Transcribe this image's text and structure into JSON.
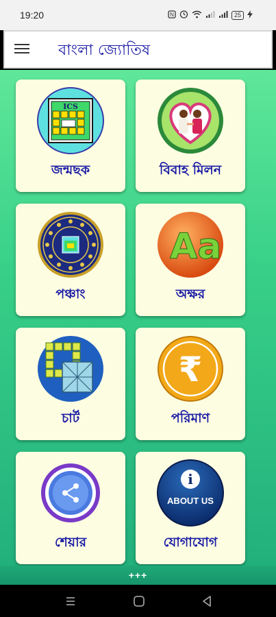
{
  "status_bar": {
    "time": "19:20",
    "icons": [
      "nfc-icon",
      "alarm-icon",
      "wifi-icon",
      "signal-icon",
      "signal-icon",
      "battery-icon"
    ],
    "battery_level": "25"
  },
  "app_bar": {
    "title": "বাংলা জ্যোতিষ",
    "menu_icon": "menu-icon"
  },
  "grid": {
    "items": [
      {
        "label": "জন্মছক",
        "icon": "ics-chart-icon"
      },
      {
        "label": "বিবাহ মিলন",
        "icon": "marriage-couple-icon"
      },
      {
        "label": "পঞ্চাং",
        "icon": "zodiac-wheel-icon"
      },
      {
        "label": "অক্ষর",
        "icon": "letters-aa-icon"
      },
      {
        "label": "চার্ট",
        "icon": "chart-grid-icon"
      },
      {
        "label": "পরিমাণ",
        "icon": "rupee-icon"
      },
      {
        "label": "শেয়ার",
        "icon": "share-icon"
      },
      {
        "label": "যোগাযোগ",
        "icon": "about-us-icon"
      }
    ],
    "icon_text": {
      "ics": "ICS",
      "aa": "Aa",
      "rupee": "₹",
      "about_i": "i",
      "about_us": "ABOUT US"
    }
  },
  "bottom": {
    "more_indicator": "+++"
  },
  "nav_bar": {
    "icons": [
      "recent-apps-icon",
      "home-icon",
      "back-icon"
    ]
  },
  "colors": {
    "title_blue": "#1a1aa6",
    "card_bg": "#fdfde1",
    "gradient_top": "#5fe79a",
    "gradient_bottom": "#22b07c"
  }
}
